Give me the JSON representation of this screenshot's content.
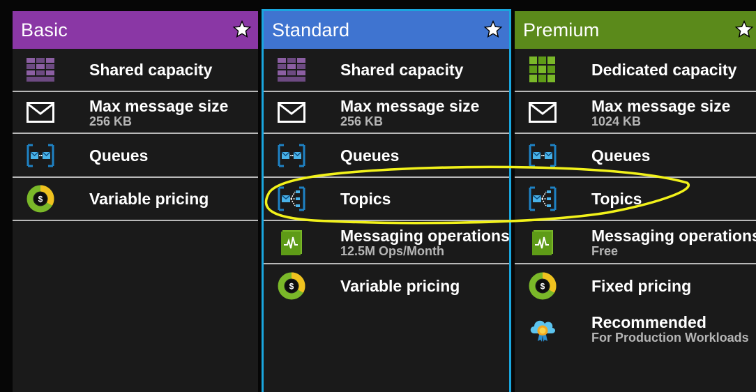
{
  "tiers": [
    {
      "name": "Basic",
      "header_color": "#8a37a5",
      "features": [
        {
          "icon": "shared-capacity-icon",
          "label": "Shared capacity"
        },
        {
          "icon": "mail-icon",
          "label": "Max message size",
          "sub": "256 KB"
        },
        {
          "icon": "queues-icon",
          "label": "Queues"
        },
        {
          "icon": "pricing-icon",
          "label": "Variable pricing"
        }
      ]
    },
    {
      "name": "Standard",
      "header_color": "#3f74d0",
      "selected": true,
      "features": [
        {
          "icon": "shared-capacity-icon",
          "label": "Shared capacity"
        },
        {
          "icon": "mail-icon",
          "label": "Max message size",
          "sub": "256 KB"
        },
        {
          "icon": "queues-icon",
          "label": "Queues"
        },
        {
          "icon": "topics-icon",
          "label": "Topics"
        },
        {
          "icon": "messaging-operations-icon",
          "label": "Messaging operations",
          "sub": "12.5M Ops/Month"
        },
        {
          "icon": "pricing-icon",
          "label": "Variable pricing"
        }
      ]
    },
    {
      "name": "Premium",
      "header_color": "#5b8a1b",
      "features": [
        {
          "icon": "dedicated-capacity-icon",
          "label": "Dedicated capacity"
        },
        {
          "icon": "mail-icon",
          "label": "Max message size",
          "sub": "1024 KB"
        },
        {
          "icon": "queues-icon",
          "label": "Queues"
        },
        {
          "icon": "topics-icon",
          "label": "Topics"
        },
        {
          "icon": "messaging-operations-icon",
          "label": "Messaging operations",
          "sub": "Free"
        },
        {
          "icon": "pricing-icon",
          "label": "Fixed pricing"
        },
        {
          "icon": "recommended-icon",
          "label": "Recommended",
          "sub": "For Production Workloads"
        }
      ]
    }
  ],
  "colors": {
    "highlight_annotation": "#f2f21a",
    "selected_outline": "#1aa6de"
  }
}
